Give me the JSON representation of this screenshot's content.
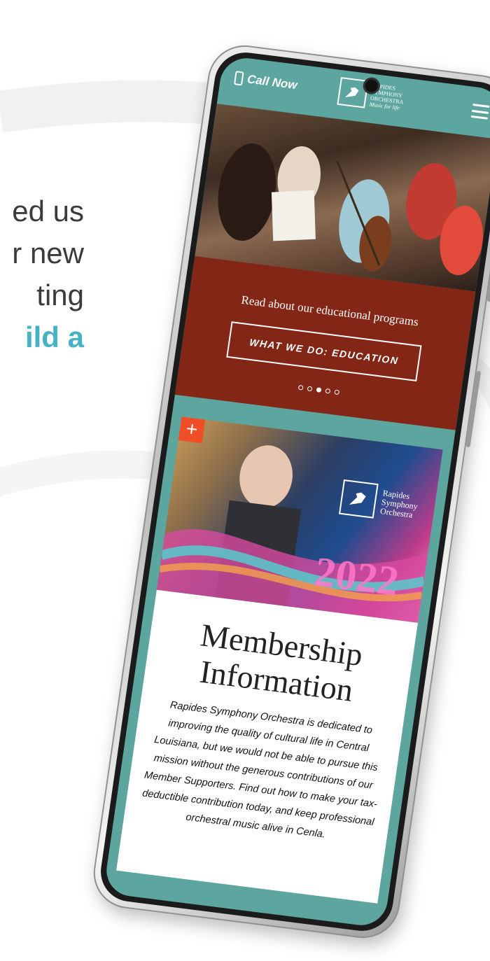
{
  "left_copy": {
    "lines": [
      "ed us",
      "r new",
      "ting",
      "ild a"
    ]
  },
  "header": {
    "call_label": "Call Now",
    "logo_line1": "Rapides",
    "logo_line2": "Symphony",
    "logo_line3": "Orchestra",
    "logo_tagline": "Music for life"
  },
  "promo": {
    "text": "Read about our educational programs",
    "button_label": "WHAT WE DO: EDUCATION",
    "slide_count": 5,
    "active_slide": 3
  },
  "membership_card": {
    "plus_symbol": "+",
    "logo_line1": "Rapides",
    "logo_line2": "Symphony",
    "logo_line3": "Orchestra",
    "year_text": "2022",
    "title_line1": "Membership",
    "title_line2": "Information",
    "description": "Rapides Symphony Orchestra is dedicated to improving the quality of cultural life in Central Louisiana, but we would not be able to pursue this mission without the generous contributions of our Member Supporters. Find out how to make your tax-deductible contribution today, and keep professional orchestral music alive in Cenla."
  },
  "colors": {
    "teal": "#5da69f",
    "brick_red": "#832615",
    "accent_teal_text": "#45b3c4",
    "plus_orange": "#f04e27"
  },
  "icons": [
    "phone-icon",
    "menu-icon",
    "plus-icon",
    "orchestra-logo-icon"
  ]
}
